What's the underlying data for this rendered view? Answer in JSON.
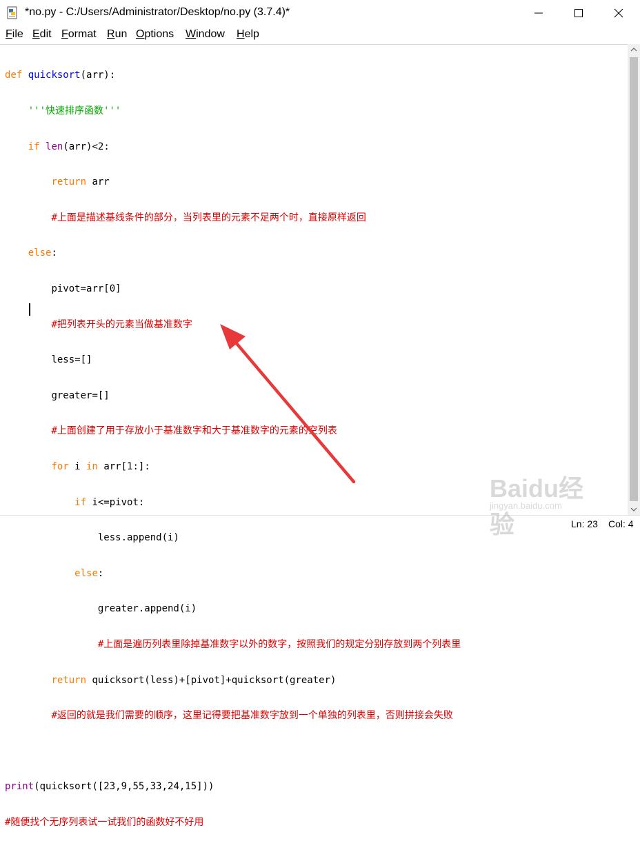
{
  "window": {
    "title": "*no.py - C:/Users/Administrator/Desktop/no.py (3.7.4)*"
  },
  "menu": [
    {
      "label": "File",
      "u": "F",
      "rest": "ile"
    },
    {
      "label": "Edit",
      "u": "E",
      "rest": "dit"
    },
    {
      "label": "Format",
      "u": "F",
      "rest": "ormat"
    },
    {
      "label": "Run",
      "u": "R",
      "rest": "un"
    },
    {
      "label": "Options",
      "u": "O",
      "rest": "ptions"
    },
    {
      "label": "Window",
      "u": "W",
      "rest": "indow"
    },
    {
      "label": "Help",
      "u": "H",
      "rest": "elp"
    }
  ],
  "code": {
    "l1_kw": "def",
    "l1_name": "quicksort",
    "l1_rest": "(arr):",
    "l2_str": "'''快速排序函数'''",
    "l3_kw": "if",
    "l3_bi": "len",
    "l3_rest": "(arr)<2:",
    "l4_kw": "return",
    "l4_rest": " arr",
    "l5_cm": "#上面是描述基线条件的部分，当列表里的元素不足两个时，直接原样返回",
    "l6_kw": "else",
    "l6_rest": ":",
    "l7": "pivot=arr[0]",
    "l8_cm": "#把列表开头的元素当做基准数字",
    "l9": "less=[]",
    "l10": "greater=[]",
    "l11_cm": "#上面创建了用于存放小于基准数字和大于基准数字的元素的空列表",
    "l12_kw1": "for",
    "l12_mid": " i ",
    "l12_kw2": "in",
    "l12_rest": " arr[1:]:",
    "l13_kw": "if",
    "l13_rest": " i<=pivot:",
    "l14": "less.append(i)",
    "l15_kw": "else",
    "l15_rest": ":",
    "l16": "greater.append(i)",
    "l17_cm": "#上面是遍历列表里除掉基准数字以外的数字，按照我们的规定分别存放到两个列表里",
    "l18_kw": "return",
    "l18_rest": " quicksort(less)+[pivot]+quicksort(greater)",
    "l19_cm": "#返回的就是我们需要的顺序，这里记得要把基准数字放到一个单独的列表里，否则拼接会失败",
    "l21_bi": "print",
    "l21_rest": "(quicksort([23,9,55,33,24,15]))",
    "l22_cm": "#随便找个无序列表试一试我们的函数好不好用"
  },
  "status": {
    "ln": "Ln: 23",
    "col": "Col: 4"
  },
  "watermark": {
    "big": "Baidu经验",
    "small": "jingyan.baidu.com"
  },
  "colors": {
    "keyword": "#ff7700",
    "builtin": "#900090",
    "definition": "#0000ff",
    "string": "#00aa00",
    "comment": "#dd0000",
    "arrow": "#e8393a"
  }
}
